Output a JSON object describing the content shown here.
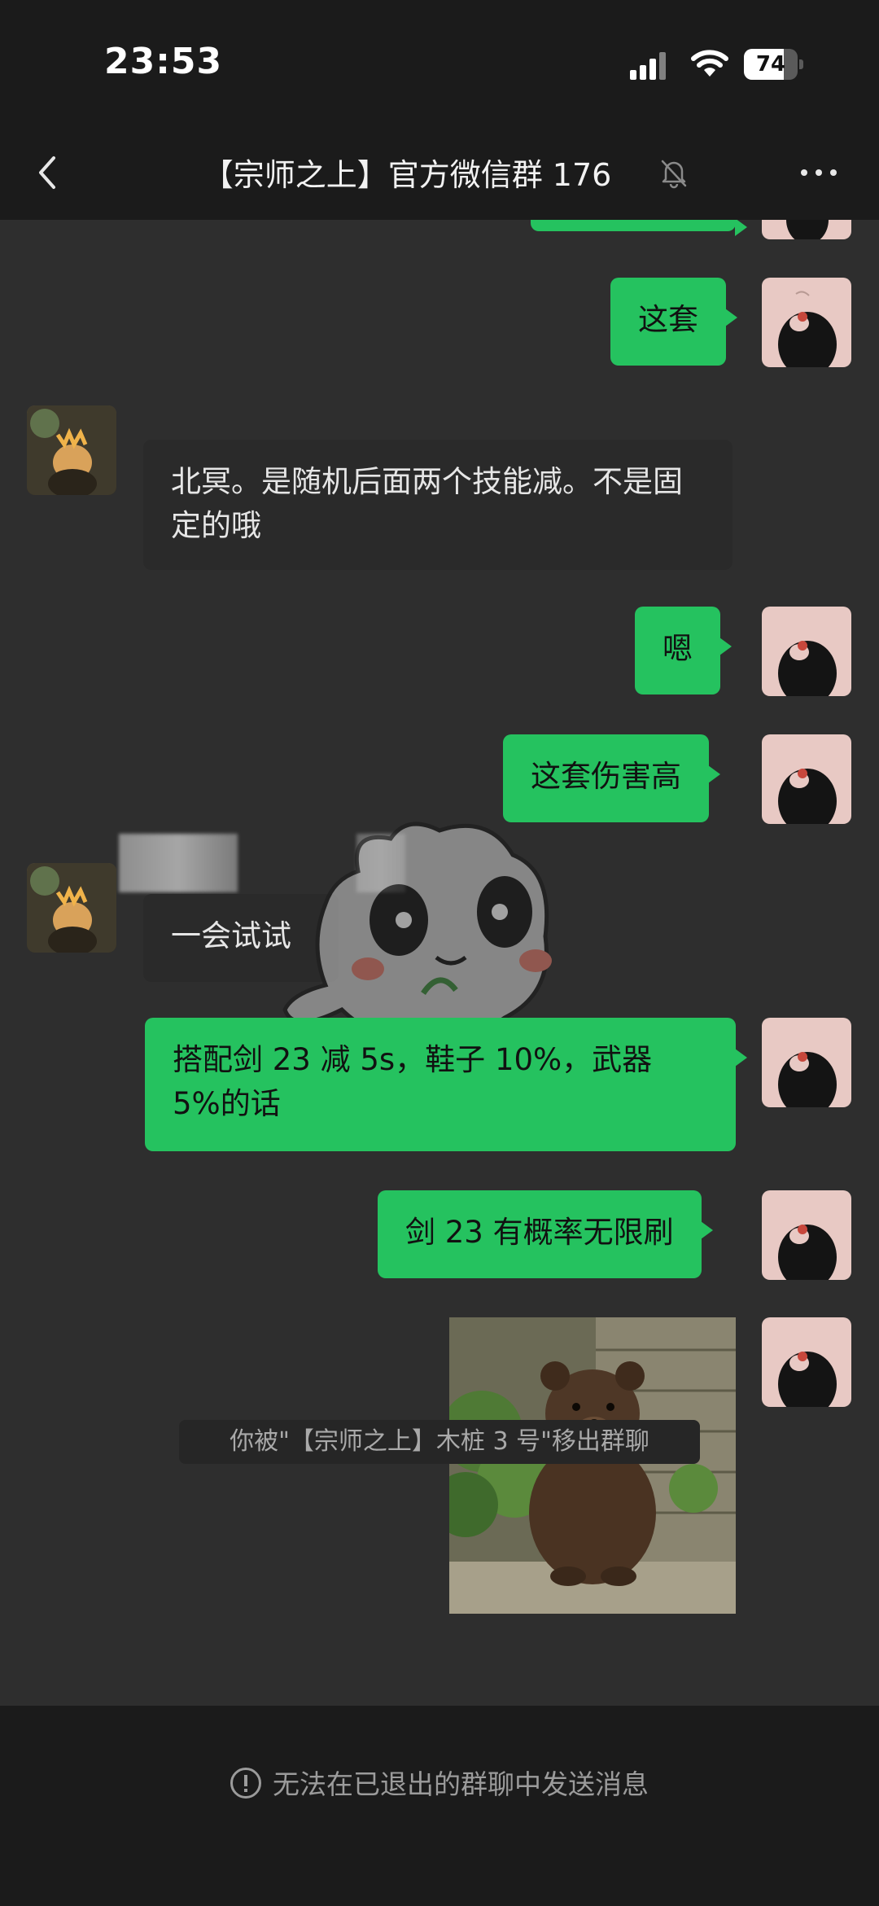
{
  "status_bar": {
    "time": "23:53",
    "battery": "74",
    "battery_level": 0.74
  },
  "header": {
    "title": "【宗师之上】官方微信群 176",
    "back_icon": "chevron-left-icon",
    "mute_icon": "bell-slash-icon",
    "more_icon": "more-dots-icon"
  },
  "messages": [
    {
      "sender": "me",
      "text": "这套"
    },
    {
      "sender": "other",
      "text": "北冥。是随机后面两个技能减。不是固定的哦"
    },
    {
      "sender": "me",
      "text": "嗯"
    },
    {
      "sender": "me",
      "text": "这套伤害高"
    },
    {
      "sender": "other",
      "text": "一会试试"
    },
    {
      "sender": "me",
      "text": "搭配剑 23 减 5s，鞋子 10%，武器 5%的话"
    },
    {
      "sender": "me",
      "text": "剑 23 有概率无限刷"
    },
    {
      "sender": "me",
      "type": "image",
      "image_icon": "bear-cub-photo"
    }
  ],
  "system_notice": "你被\"【宗师之上】木桩 3 号\"移出群聊",
  "footer": {
    "notice": "无法在已退出的群聊中发送消息",
    "icon": "info-icon"
  },
  "colors": {
    "chat_bg": "#2e2e2e",
    "bar_bg": "#1b1b1b",
    "my_bubble": "#25c25f",
    "other_bubble": "#2a2a2a"
  }
}
